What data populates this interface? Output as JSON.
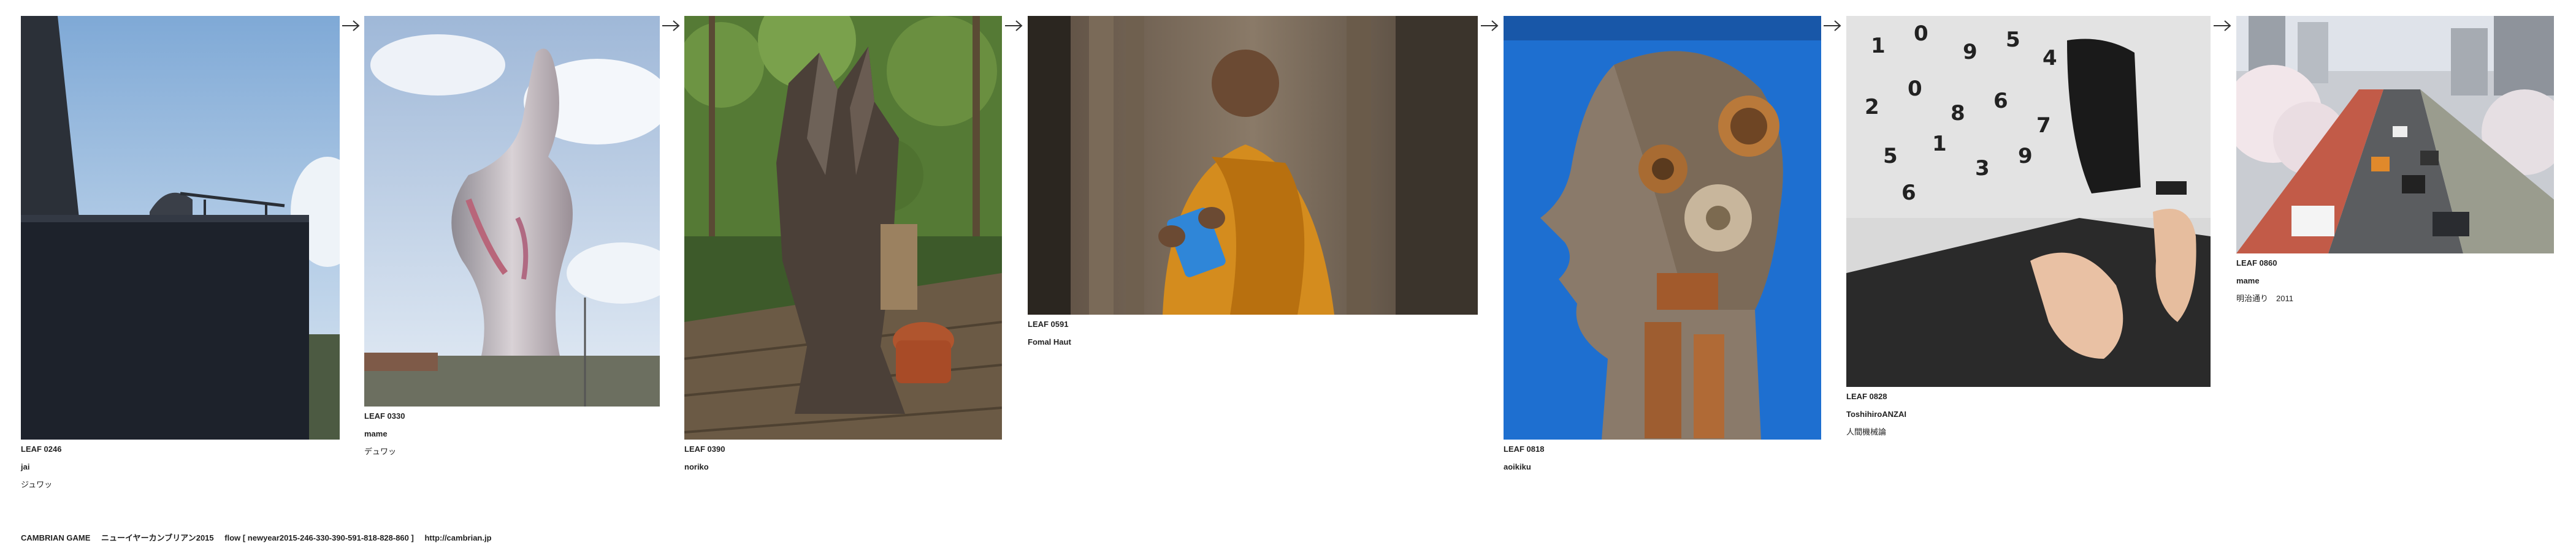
{
  "leaves": [
    {
      "code": "LEAF 0246",
      "author": "jai",
      "caption": "ジュワッ"
    },
    {
      "code": "LEAF 0330",
      "author": "mame",
      "caption": "デュワッ"
    },
    {
      "code": "LEAF 0390",
      "author": "noriko",
      "caption": ""
    },
    {
      "code": "LEAF 0591",
      "author": "Fomal Haut",
      "caption": ""
    },
    {
      "code": "LEAF 0818",
      "author": "aoikiku",
      "caption": ""
    },
    {
      "code": "LEAF 0828",
      "author": "ToshihiroANZAI",
      "caption": "人間機械論"
    },
    {
      "code": "LEAF 0860",
      "author": "mame",
      "caption": "明治通り　2011"
    }
  ],
  "footer": {
    "title": "CAMBRIAN GAME",
    "subtitle": "ニューイヤーカンブリアン2015",
    "flow": "flow [ newyear2015-246-330-390-591-818-828-860 ]",
    "url": "http://cambrian.jp"
  },
  "icons": {
    "arrow": "right-arrow-icon"
  },
  "colors": {
    "text": "#222222",
    "background": "#ffffff"
  }
}
